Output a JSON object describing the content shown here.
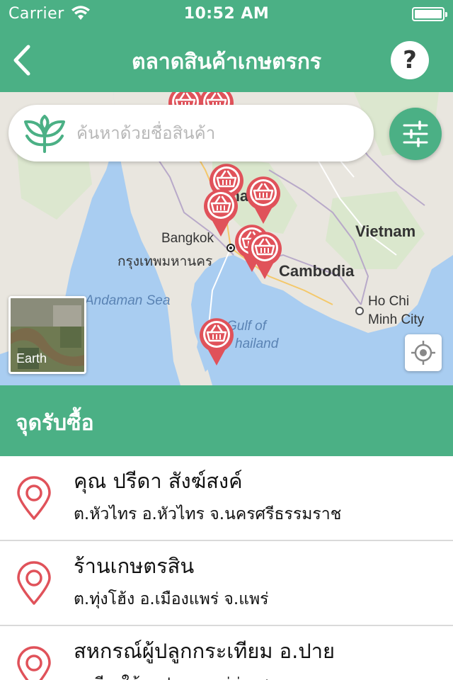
{
  "status_bar": {
    "carrier": "Carrier",
    "time": "10:52 AM"
  },
  "nav": {
    "title": "ตลาดสินค้าเกษตรกร",
    "help_label": "?"
  },
  "search": {
    "placeholder": "ค้นหาด้วยชื่อสินค้า"
  },
  "map": {
    "labels": {
      "vietnam": "Vietnam",
      "cambodia": "Cambodia",
      "bangkok": "Bangkok",
      "bangkok_thai": "กรุงเทพมหานคร",
      "andaman_sea": "Andaman Sea",
      "gulf_line1": "Gulf of",
      "gulf_line2": "hailand",
      "hochiminh_line1": "Ho Chi",
      "hochiminh_line2": "Minh City",
      "thailand_partial": "Thai"
    },
    "earth_label": "Earth",
    "colors": {
      "water": "#a9cdf1",
      "land": "#e9e6df",
      "pin": "#e0525a"
    }
  },
  "section": {
    "title": "จุดรับซื้อ"
  },
  "buyers": [
    {
      "name": "คุณ ปรีดา  สังฆ์สงค์",
      "address": "ต.หัวไทร อ.หัวไทร จ.นครศรีธรรมราช"
    },
    {
      "name": "ร้านเกษตรสิน",
      "address": "ต.ทุ่งโฮ้ง อ.เมืองแพร่ จ.แพร่"
    },
    {
      "name": "สหกรณ์ผู้ปลูกกระเทียม อ.ปาย",
      "address": "ต.เวียงใต้ อ.ปาย จ.แม่ฮ่องสอน"
    }
  ],
  "theme": {
    "primary": "#4bb085",
    "pin_red": "#e0525a"
  }
}
